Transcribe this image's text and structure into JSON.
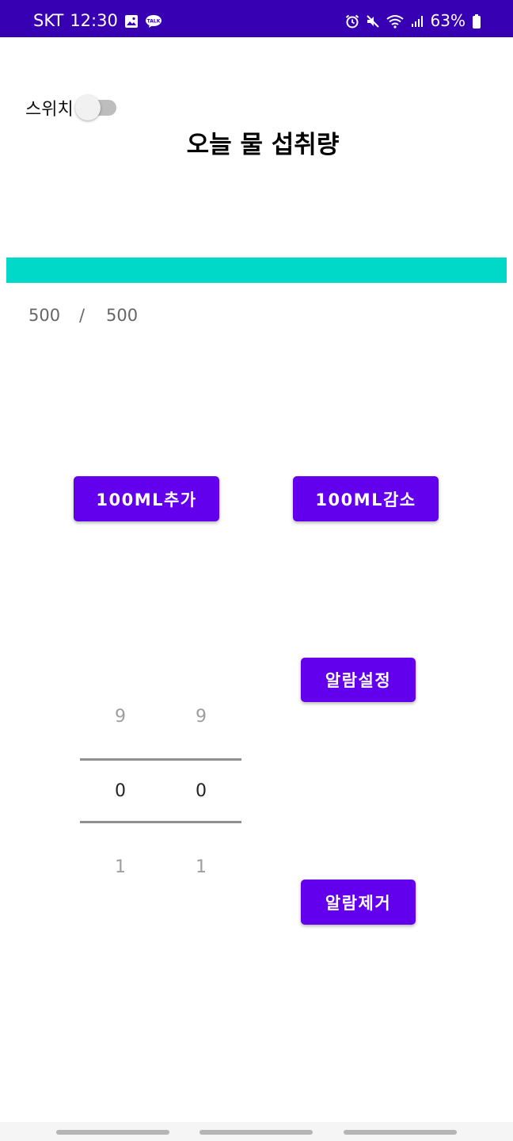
{
  "status_bar": {
    "carrier": "SKT",
    "time": "12:30",
    "battery": "63%",
    "left_icons": [
      "gallery-icon",
      "kakaotalk-icon"
    ],
    "right_icons": [
      "alarm-icon",
      "mute-icon",
      "wifi-icon",
      "signal-icon",
      "battery-icon"
    ],
    "color": "#3700b3"
  },
  "header": {
    "switch_label": "스위치",
    "switch_on": false,
    "title": "오늘 물 섭취량"
  },
  "progress": {
    "current": "500",
    "separator": "/",
    "goal": "500",
    "fill_fraction": 1.0,
    "color": "#00d9c8"
  },
  "buttons": {
    "add": "100ML추가",
    "subtract": "100ML감소",
    "set_alarm": "알람설정",
    "remove_alarm": "알람제거",
    "color": "#6200ee"
  },
  "time_picker": {
    "hour": {
      "prev": "9",
      "current": "0",
      "next": "1"
    },
    "minute": {
      "prev": "9",
      "current": "0",
      "next": "1"
    }
  }
}
